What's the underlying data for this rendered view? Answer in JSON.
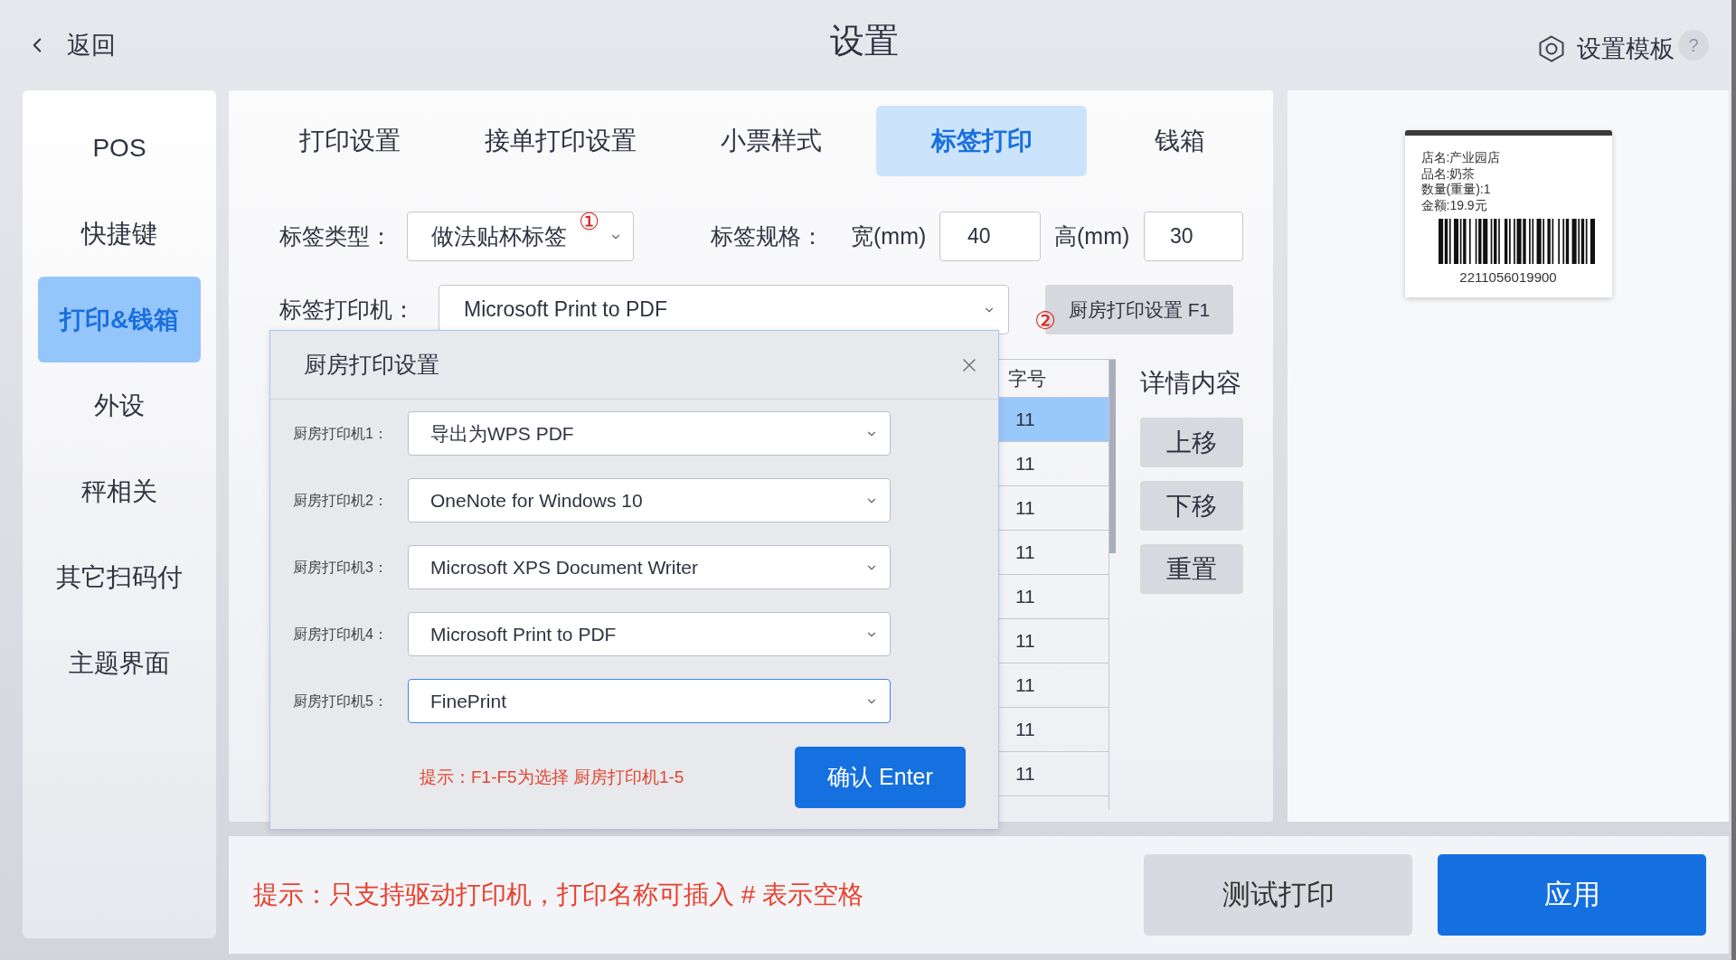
{
  "header": {
    "back": "返回",
    "title": "设置",
    "template_button": "设置模板",
    "help_button": "?"
  },
  "sidebar": {
    "items": [
      {
        "label": "POS",
        "selected": false
      },
      {
        "label": "快捷键",
        "selected": false
      },
      {
        "label": "打印&钱箱",
        "selected": true
      },
      {
        "label": "外设",
        "selected": false
      },
      {
        "label": "秤相关",
        "selected": false
      },
      {
        "label": "其它扫码付",
        "selected": false
      },
      {
        "label": "主题界面",
        "selected": false
      }
    ]
  },
  "tabs": [
    {
      "label": "打印设置",
      "selected": false
    },
    {
      "label": "接单打印设置",
      "selected": false
    },
    {
      "label": "小票样式",
      "selected": false
    },
    {
      "label": "标签打印",
      "selected": true
    },
    {
      "label": "钱箱",
      "selected": false
    }
  ],
  "label_form": {
    "label_type": {
      "label": "标签类型：",
      "value": "做法贴杯标签",
      "marker": "①"
    },
    "label_size": {
      "label": "标签规格：",
      "width_label": "宽(mm)",
      "width_value": "40",
      "height_label": "高(mm)",
      "height_value": "30"
    },
    "label_printer": {
      "label": "标签打印机：",
      "value": "Microsoft Print to PDF"
    },
    "kitchen_button": {
      "label": "厨房打印设置 F1",
      "marker": "②"
    }
  },
  "table": {
    "columns": [
      "字号"
    ],
    "rows": [
      {
        "cells": [
          "11"
        ],
        "selected": true
      },
      {
        "cells": [
          "11"
        ],
        "selected": false
      },
      {
        "cells": [
          "11"
        ],
        "selected": false
      },
      {
        "cells": [
          "11"
        ],
        "selected": false
      },
      {
        "cells": [
          "11"
        ],
        "selected": false
      },
      {
        "cells": [
          "11"
        ],
        "selected": false
      },
      {
        "cells": [
          "11"
        ],
        "selected": false
      },
      {
        "cells": [
          "11"
        ],
        "selected": false
      },
      {
        "cells": [
          "11"
        ],
        "selected": false
      }
    ]
  },
  "detail": {
    "title": "详情内容",
    "buttons": [
      "上移",
      "下移",
      "重置"
    ]
  },
  "preview": {
    "lines": [
      "店名:产业园店",
      "品名:奶茶",
      "数量(重量):1",
      "金额:19.9元"
    ],
    "barcode_number": "2211056019900"
  },
  "footer": {
    "hint": "提示：只支持驱动打印机，打印名称可插入 # 表示空格",
    "buttons": [
      {
        "label": "测试打印",
        "kind": "secondary"
      },
      {
        "label": "应用",
        "kind": "primary"
      }
    ]
  },
  "dialog": {
    "title": "厨房打印设置",
    "printers": [
      {
        "label": "厨房打印机1：",
        "value": "导出为WPS PDF",
        "focused": false
      },
      {
        "label": "厨房打印机2：",
        "value": "OneNote for Windows 10",
        "focused": false
      },
      {
        "label": "厨房打印机3：",
        "value": "Microsoft XPS Document Writer",
        "focused": false
      },
      {
        "label": "厨房打印机4：",
        "value": "Microsoft Print to PDF",
        "focused": false
      },
      {
        "label": "厨房打印机5：",
        "value": "FinePrint",
        "focused": true
      }
    ],
    "hint": "提示：F1-F5为选择 厨房打印机1-5",
    "confirm_button": "确认 Enter"
  }
}
